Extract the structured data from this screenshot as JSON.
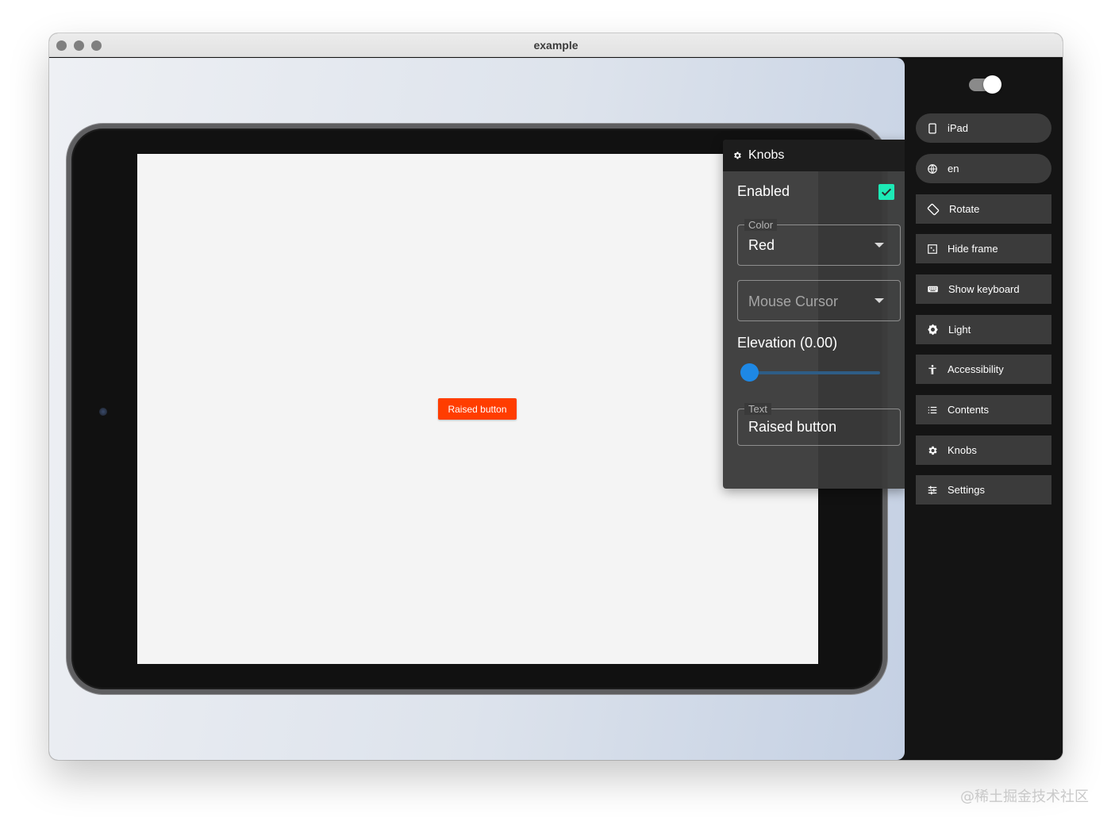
{
  "window": {
    "title": "example"
  },
  "device": {
    "button_label": "Raised button",
    "button_color": "#ff3d00",
    "screen_color": "#f4f4f4"
  },
  "knobs": {
    "title": "Knobs",
    "icon": "gear-icon",
    "enabled_label": "Enabled",
    "enabled_checked": true,
    "color_field": {
      "label": "Color",
      "value": "Red"
    },
    "mouse_cursor_field": {
      "placeholder": "Mouse Cursor"
    },
    "elevation_label": "Elevation (0.00)",
    "elevation_value": 0.0,
    "text_field": {
      "label": "Text",
      "value": "Raised button"
    },
    "accent_color": "#1de9b6"
  },
  "toolbar": {
    "dark_mode_toggle": true,
    "buttons": [
      {
        "label": "iPad",
        "icon": "tablet-icon"
      },
      {
        "label": "en",
        "icon": "globe-icon"
      },
      {
        "label": "Rotate",
        "icon": "rotate-icon"
      },
      {
        "label": "Hide frame",
        "icon": "frame-icon"
      },
      {
        "label": "Show keyboard",
        "icon": "keyboard-icon"
      },
      {
        "label": "Light",
        "icon": "brightness-icon"
      },
      {
        "label": "Accessibility",
        "icon": "accessibility-icon"
      },
      {
        "label": "Contents",
        "icon": "list-icon"
      },
      {
        "label": "Knobs",
        "icon": "gear-icon"
      },
      {
        "label": "Settings",
        "icon": "tune-icon"
      }
    ]
  },
  "watermark": "@稀土掘金技术社区"
}
